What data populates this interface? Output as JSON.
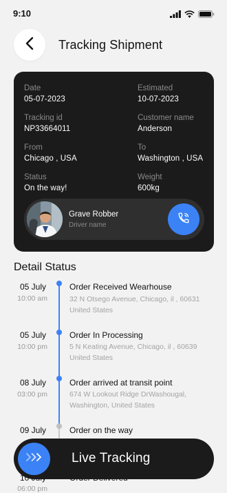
{
  "status_bar": {
    "time": "9:10"
  },
  "header": {
    "title": "Tracking Shipment"
  },
  "shipment": {
    "date_label": "Date",
    "date": "05-07-2023",
    "estimated_label": "Estimated",
    "estimated": "10-07-2023",
    "tracking_label": "Tracking id",
    "tracking_id": "NP33664011",
    "customer_label": "Customer name",
    "customer": "Anderson",
    "from_label": "From",
    "from": "Chicago , USA",
    "to_label": "To",
    "to": "Washington , USA",
    "status_label": "Status",
    "status": "On the way!",
    "weight_label": "Weight",
    "weight": "600kg"
  },
  "driver": {
    "name": "Grave Robber",
    "role": "Driver name"
  },
  "detail": {
    "title": "Detail Status",
    "events": [
      {
        "date": "05 July",
        "time": "10:00 am",
        "title": "Order Received Wearhouse",
        "addr1": "32 N Otsego Avenue, Chicago, il , 60631",
        "addr2": "United States"
      },
      {
        "date": "05 July",
        "time": "10:00 pm",
        "title": "Order In Processing",
        "addr1": "5 N Keating Avenue, Chicago, il , 60639",
        "addr2": "United States"
      },
      {
        "date": "08 July",
        "time": "03:00 pm",
        "title": "Order arrived at transit point",
        "addr1": "674 W Lookout Ridge DrWashougal,",
        "addr2": "Washington, United States"
      },
      {
        "date": "09 July",
        "time": "",
        "title": "Order on the way",
        "addr1": "",
        "addr2": ""
      },
      {
        "date": "10 July",
        "time": "06:00 pm",
        "title": "Order Delivered",
        "addr1": "",
        "addr2": ""
      }
    ]
  },
  "live_tracking": {
    "label": "Live Tracking"
  },
  "colors": {
    "accent": "#3b82f6",
    "card": "#1b1b1b",
    "background": "#f2f2f2"
  }
}
